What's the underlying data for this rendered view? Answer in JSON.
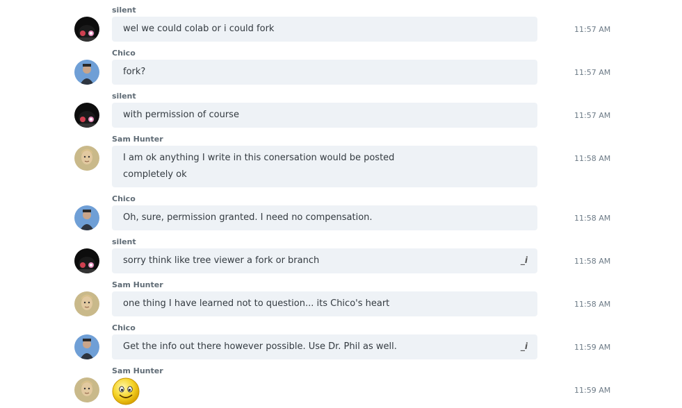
{
  "messages": [
    {
      "sender": "silent",
      "text": [
        "wel we could colab or i could fork"
      ],
      "time": "11:57 AM",
      "avatar": "silent",
      "edited": false
    },
    {
      "sender": "Chico",
      "text": [
        "fork?"
      ],
      "time": "11:57 AM",
      "avatar": "chico",
      "edited": false
    },
    {
      "sender": "silent",
      "text": [
        "with permission of course"
      ],
      "time": "11:57 AM",
      "avatar": "silent",
      "edited": false
    },
    {
      "sender": "Sam Hunter",
      "text": [
        "I am ok anything I write in this conersation would be posted",
        "completely ok"
      ],
      "time": "11:58 AM",
      "avatar": "sam",
      "edited": false
    },
    {
      "sender": "Chico",
      "text": [
        "Oh, sure, permission granted.  I need no compensation."
      ],
      "time": "11:58 AM",
      "avatar": "chico",
      "edited": false
    },
    {
      "sender": "silent",
      "text": [
        "sorry think like tree viewer a fork or branch"
      ],
      "time": "11:58 AM",
      "avatar": "silent",
      "edited": true,
      "edit_mark": "_i"
    },
    {
      "sender": "Sam Hunter",
      "text": [
        "one thing I have learned not to question... its Chico's heart"
      ],
      "time": "11:58 AM",
      "avatar": "sam",
      "edited": false
    },
    {
      "sender": "Chico",
      "text": [
        "Get the info out there however possible.  Use Dr. Phil as well."
      ],
      "time": "11:59 AM",
      "avatar": "chico",
      "edited": true,
      "edit_mark": "_i"
    },
    {
      "sender": "Sam Hunter",
      "text": [],
      "time": "11:59 AM",
      "avatar": "sam",
      "edited": false,
      "emoji": "smiley-emoticon"
    }
  ]
}
